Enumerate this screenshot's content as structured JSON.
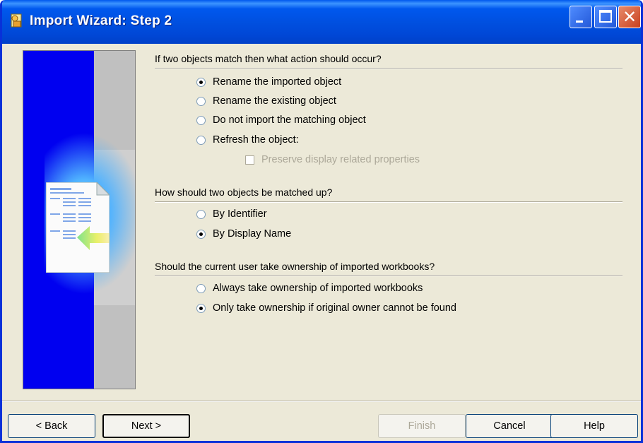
{
  "window": {
    "title": "Import Wizard: Step 2",
    "icons": {
      "app": "wizard-app-icon",
      "minimize": "minimize-icon",
      "maximize": "maximize-icon",
      "close": "close-icon"
    }
  },
  "match_action": {
    "label": "If two objects match then what action should occur?",
    "options": [
      {
        "label": "Rename the imported object",
        "selected": true
      },
      {
        "label": "Rename the existing object",
        "selected": false
      },
      {
        "label": "Do not import the matching object",
        "selected": false
      },
      {
        "label": "Refresh the object:",
        "selected": false
      }
    ],
    "preserve_label": "Preserve display related properties",
    "preserve_checked": false,
    "preserve_enabled": false
  },
  "match_by": {
    "label": "How should two objects be matched up?",
    "options": [
      {
        "label": "By Identifier",
        "selected": false
      },
      {
        "label": "By Display Name",
        "selected": true
      }
    ]
  },
  "ownership": {
    "label": "Should the current user take ownership of imported workbooks?",
    "options": [
      {
        "label": "Always take ownership of imported workbooks",
        "selected": false
      },
      {
        "label": "Only take ownership if original owner cannot be found",
        "selected": true
      }
    ]
  },
  "buttons": {
    "back": "< Back",
    "next": "Next >",
    "finish": "Finish",
    "cancel": "Cancel",
    "help": "Help"
  },
  "colors": {
    "titlebar": "#0058ee",
    "panel_blue": "#0000f0",
    "dialog_bg": "#ece9d8"
  }
}
